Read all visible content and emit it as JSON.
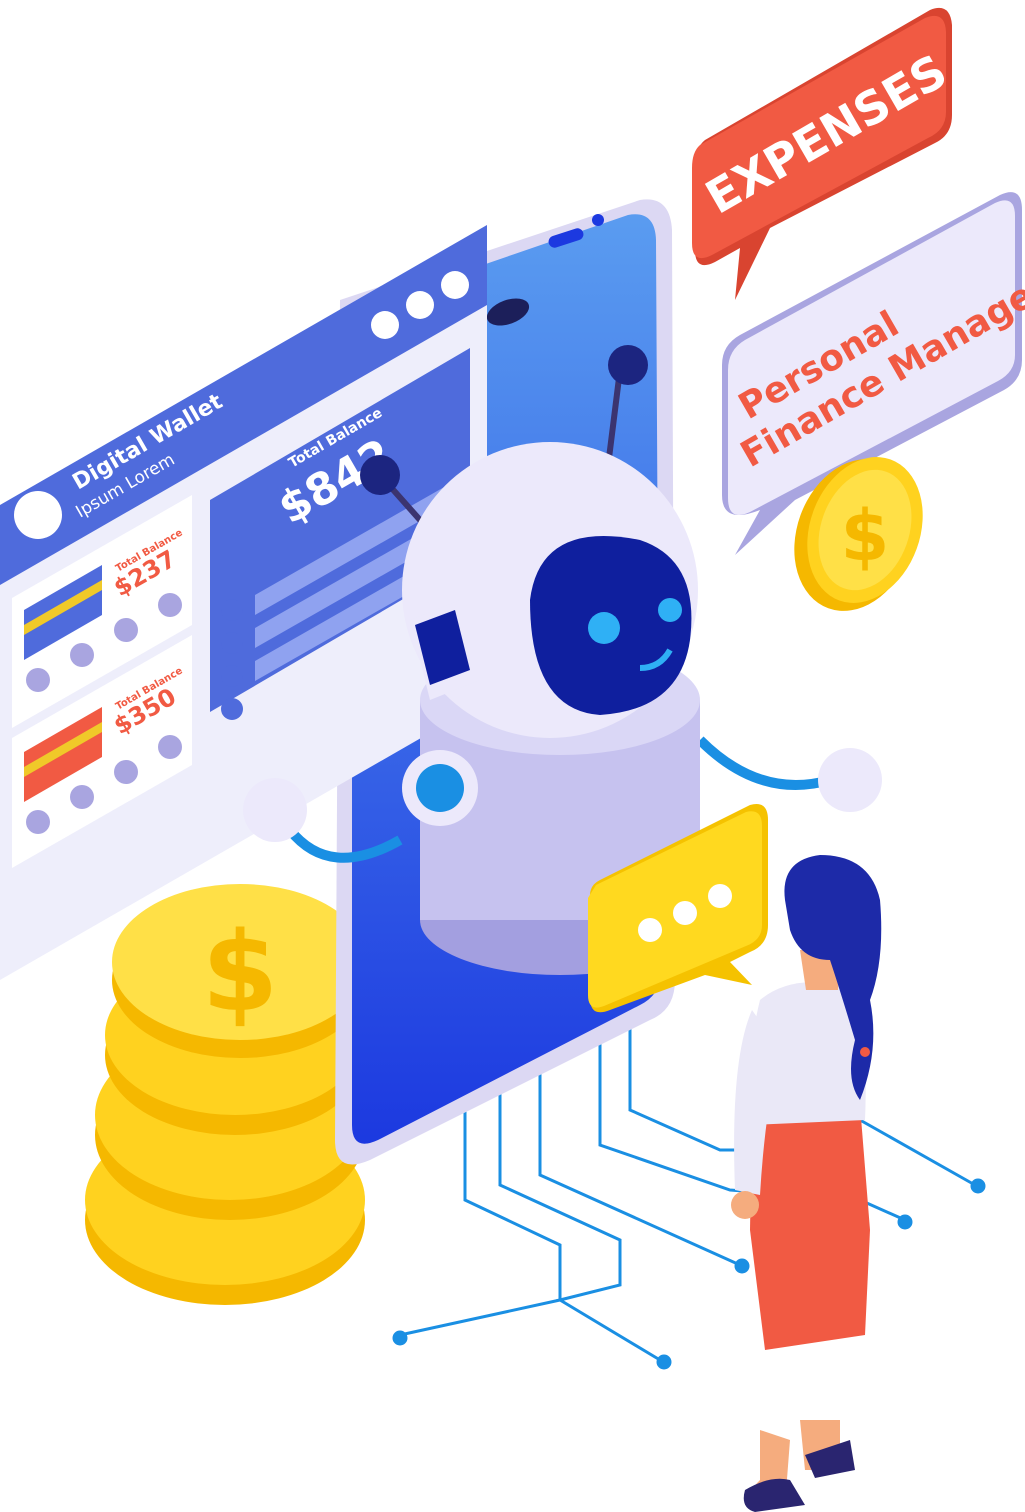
{
  "wallet": {
    "title": "Digital Wallet",
    "subtitle": "Ipsum Lorem",
    "total_label": "Total Balance",
    "total_value": "$842",
    "cards": [
      {
        "label": "Total Balance",
        "value": "$237",
        "color": "#f0c929"
      },
      {
        "label": "Total Balance",
        "value": "$350",
        "color": "#f15a43"
      }
    ]
  },
  "bubbles": {
    "expenses": "EXPENSES",
    "manager_line1": "Personal",
    "manager_line2": "Finance Manager"
  },
  "colors": {
    "accent_blue": "#4f6bdc",
    "accent_red": "#f15a43",
    "coin_yellow": "#ffd21f",
    "phone_blue": "#2f5ee8",
    "circuit_blue": "#1a8fe3"
  }
}
